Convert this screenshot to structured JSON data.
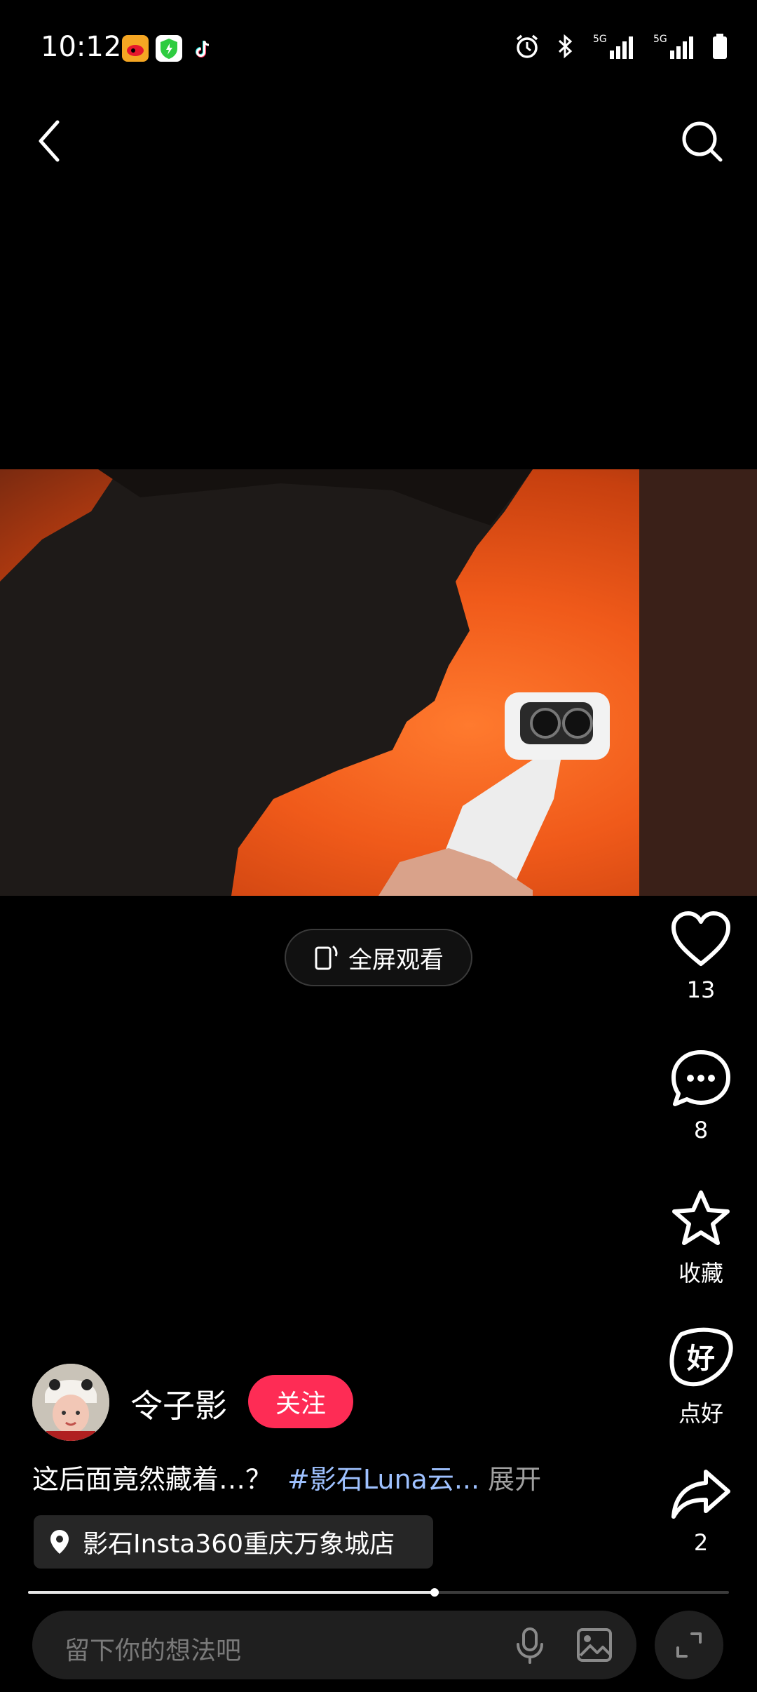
{
  "status_bar": {
    "time": "10:12"
  },
  "video": {
    "fullscreen_label": "全屏观看"
  },
  "actions": {
    "like_count": "13",
    "comment_count": "8",
    "favorite_label": "收藏",
    "good_label": "点好",
    "share_count": "2"
  },
  "author": {
    "name": "令子影",
    "follow_label": "关注"
  },
  "caption": {
    "text": "这后面竟然藏着…？",
    "hashtag": "#影石Luna云...",
    "expand": "展开"
  },
  "location": {
    "label": "影石Insta360重庆万象城店"
  },
  "progress": {
    "fraction": 0.58
  },
  "comment": {
    "placeholder": "留下你的想法吧"
  },
  "colors": {
    "accent": "#fe2c55",
    "hashtag": "#9ec1ff",
    "background": "#000000"
  }
}
